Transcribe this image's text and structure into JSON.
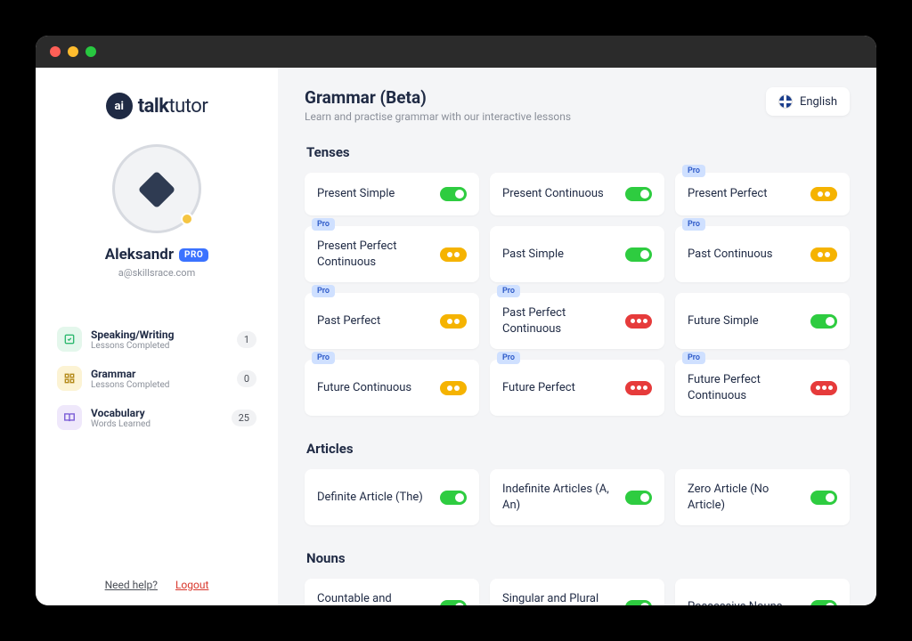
{
  "brand": {
    "badge": "ai",
    "name_a": "talk",
    "name_b": "tutor"
  },
  "user": {
    "name": "Aleksandr",
    "badge": "PRO",
    "email": "a@skillsrace.com"
  },
  "stats": [
    {
      "title": "Speaking/Writing",
      "sub": "Lessons Completed",
      "count": "1"
    },
    {
      "title": "Grammar",
      "sub": "Lessons Completed",
      "count": "0"
    },
    {
      "title": "Vocabulary",
      "sub": "Words Learned",
      "count": "25"
    }
  ],
  "footer": {
    "help": "Need help?",
    "logout": "Logout"
  },
  "header": {
    "title": "Grammar (Beta)",
    "subtitle": "Learn and practise grammar with our interactive lessons",
    "language": "English"
  },
  "sections": [
    {
      "title": "Tenses",
      "cards": [
        {
          "label": "Present Simple",
          "level": "green",
          "pro": false
        },
        {
          "label": "Present Continuous",
          "level": "green",
          "pro": false
        },
        {
          "label": "Present Perfect",
          "level": "yellow",
          "pro": true
        },
        {
          "label": "Present Perfect Continuous",
          "level": "yellow",
          "pro": true
        },
        {
          "label": "Past Simple",
          "level": "green",
          "pro": false
        },
        {
          "label": "Past Continuous",
          "level": "yellow",
          "pro": true
        },
        {
          "label": "Past Perfect",
          "level": "yellow",
          "pro": true
        },
        {
          "label": "Past Perfect Continuous",
          "level": "red",
          "pro": true
        },
        {
          "label": "Future Simple",
          "level": "green",
          "pro": false
        },
        {
          "label": "Future Continuous",
          "level": "yellow",
          "pro": true
        },
        {
          "label": "Future Perfect",
          "level": "red",
          "pro": true
        },
        {
          "label": "Future Perfect Continuous",
          "level": "red",
          "pro": true
        }
      ]
    },
    {
      "title": "Articles",
      "cards": [
        {
          "label": "Definite Article (The)",
          "level": "green",
          "pro": false
        },
        {
          "label": "Indefinite Articles (A, An)",
          "level": "green",
          "pro": false
        },
        {
          "label": "Zero Article (No Article)",
          "level": "green",
          "pro": false
        }
      ]
    },
    {
      "title": "Nouns",
      "cards": [
        {
          "label": "Countable and Uncountable Nouns",
          "level": "green",
          "pro": false
        },
        {
          "label": "Singular and Plural Nouns",
          "level": "green",
          "pro": false
        },
        {
          "label": "Possessive Nouns",
          "level": "green",
          "pro": false
        }
      ]
    }
  ],
  "pro_tag": "Pro"
}
